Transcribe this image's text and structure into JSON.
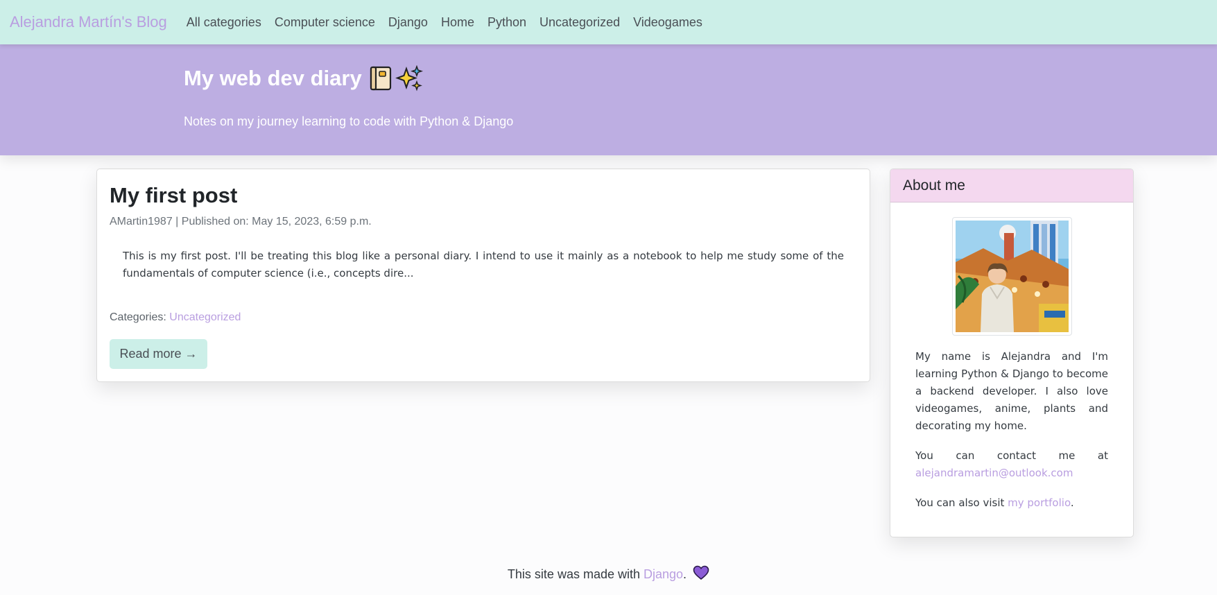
{
  "navbar": {
    "brand": "Alejandra Martín's Blog",
    "items": [
      {
        "label": "All categories"
      },
      {
        "label": "Computer science"
      },
      {
        "label": "Django"
      },
      {
        "label": "Home"
      },
      {
        "label": "Python"
      },
      {
        "label": "Uncategorized"
      },
      {
        "label": "Videogames"
      }
    ]
  },
  "hero": {
    "title": "My web dev diary",
    "title_icons": [
      "notebook-icon",
      "sparkles-icon"
    ],
    "subtitle": "Notes on my journey learning to code with Python & Django"
  },
  "post": {
    "title": "My first post",
    "meta": "AMartin1987 | Published on: May 15, 2023, 6:59 p.m.",
    "excerpt": "This is my first post. I'll be treating this blog like a personal diary. I intend to use it mainly as a notebook to help me study some of the fundamentals of computer science (i.e., concepts dire...",
    "categories_label": "Categories: ",
    "category": "Uncategorized",
    "read_more": "Read more →"
  },
  "sidebar": {
    "title": "About me",
    "bio": "My name is Alejandra and I'm learning Python & Django to become a backend developer. I also love videogames, anime, plants and decorating my home.",
    "contact_prefix": "You can contact me at",
    "email": "alejandramartin@outlook.com",
    "portfolio_prefix": "You can also visit ",
    "portfolio_link": "my portfolio",
    "portfolio_suffix": "."
  },
  "footer": {
    "prefix": "This site was made with ",
    "link": "Django",
    "suffix": ".",
    "icon": "purple-heart-icon"
  },
  "colors": {
    "navbar_bg": "#ccefe8",
    "hero_bg": "#bdaee2",
    "accent_link": "#b99ee0",
    "sidebar_header_bg": "#f4d8ef",
    "button_bg": "#ccefe8"
  }
}
